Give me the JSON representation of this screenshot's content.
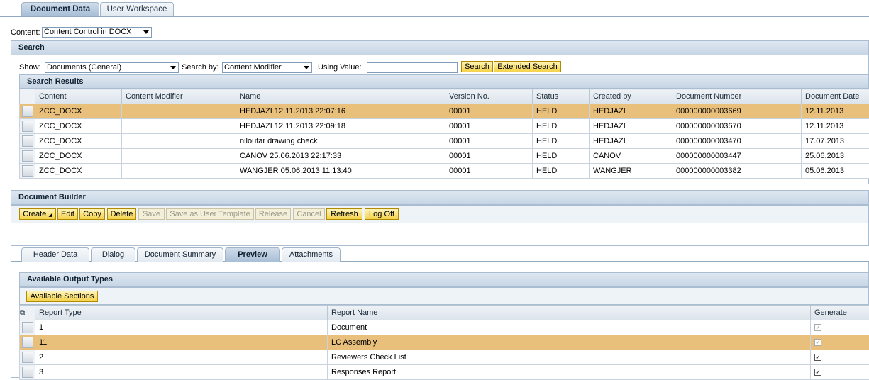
{
  "top_tabs": [
    "Document Data",
    "User Workspace"
  ],
  "content": {
    "label": "Content:",
    "value": "Content Control in DOCX"
  },
  "search": {
    "title": "Search",
    "show_label": "Show:",
    "show_value": "Documents (General)",
    "search_by_label": "Search by:",
    "search_by_value": "Content Modifier",
    "using_label": "Using Value:",
    "using_value": "",
    "search_btn": "Search",
    "ext_btn": "Extended Search"
  },
  "results": {
    "title": "Search Results",
    "columns": [
      "Content",
      "Content Modifier",
      "Name",
      "Version No.",
      "Status",
      "Created by",
      "Document Number",
      "Document Date"
    ],
    "rows": [
      [
        "ZCC_DOCX",
        "",
        "HEDJAZI 12.11.2013 22:07:16",
        "00001",
        "HELD",
        "HEDJAZI",
        "000000000003669",
        "12.11.2013"
      ],
      [
        "ZCC_DOCX",
        "",
        "HEDJAZI 12.11.2013 22:09:18",
        "00001",
        "HELD",
        "HEDJAZI",
        "000000000003670",
        "12.11.2013"
      ],
      [
        "ZCC_DOCX",
        "",
        "niloufar drawing check",
        "00001",
        "HELD",
        "HEDJAZI",
        "000000000003470",
        "17.07.2013"
      ],
      [
        "ZCC_DOCX",
        "",
        "CANOV 25.06.2013 22:17:33",
        "00001",
        "HELD",
        "CANOV",
        "000000000003447",
        "25.06.2013"
      ],
      [
        "ZCC_DOCX",
        "",
        "WANGJER 05.06.2013 11:13:40",
        "00001",
        "HELD",
        "WANGJER",
        "000000000003382",
        "05.06.2013"
      ]
    ]
  },
  "builder": {
    "title": "Document Builder",
    "buttons": {
      "create": "Create",
      "edit": "Edit",
      "copy": "Copy",
      "delete": "Delete",
      "save": "Save",
      "save_template": "Save as User Template",
      "release": "Release",
      "cancel": "Cancel",
      "refresh": "Refresh",
      "logoff": "Log Off"
    }
  },
  "detail_tabs": [
    "Header Data",
    "Dialog",
    "Document Summary",
    "Preview",
    "Attachments"
  ],
  "output": {
    "title": "Available Output Types",
    "sections_btn": "Available Sections",
    "columns": [
      "Report Type",
      "Report Name",
      "Generate"
    ],
    "rows": [
      {
        "type": "1",
        "name": "Document",
        "generate": "✓"
      },
      {
        "type": "11",
        "name": "LC Assembly",
        "generate": "✓"
      },
      {
        "type": "2",
        "name": "Reviewers Check List",
        "generate": "✓"
      },
      {
        "type": "3",
        "name": "Responses Report",
        "generate": "✓"
      }
    ]
  }
}
